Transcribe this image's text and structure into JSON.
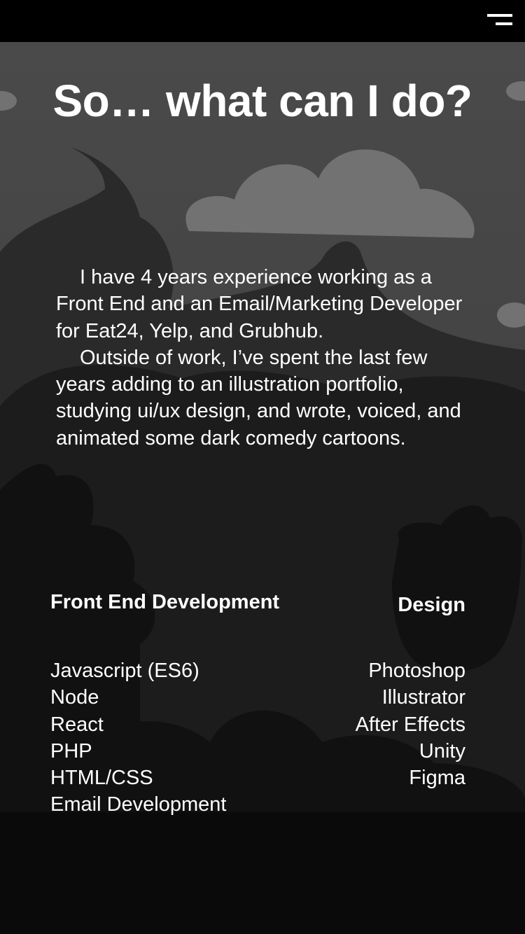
{
  "header": {
    "menu_icon": "menu-icon"
  },
  "hero": {
    "title": "So… what can I do?"
  },
  "bio": {
    "paragraph_1": "I have 4 years experience working as a Front End and an Email/Marketing Developer for Eat24, Yelp, and Grubhub.",
    "paragraph_2": "Outside of work, I’ve spent the last few years adding to an illustration portfolio, studying ui/ux design, and wrote, voiced, and animated some dark comedy cartoons."
  },
  "skills": {
    "front_end": {
      "heading": "Front End Development",
      "items": [
        "Javascript (ES6)",
        "Node",
        "React",
        "PHP",
        "HTML/CSS",
        "Email Development"
      ]
    },
    "design": {
      "heading": "Design",
      "items": [
        "Photoshop",
        "Illustrator",
        "After Effects",
        "Unity",
        "Figma"
      ]
    }
  },
  "colors": {
    "background": "#0a0a0b",
    "sky": "#4c4c4c",
    "cloud": "#737373",
    "text": "#ffffff"
  }
}
